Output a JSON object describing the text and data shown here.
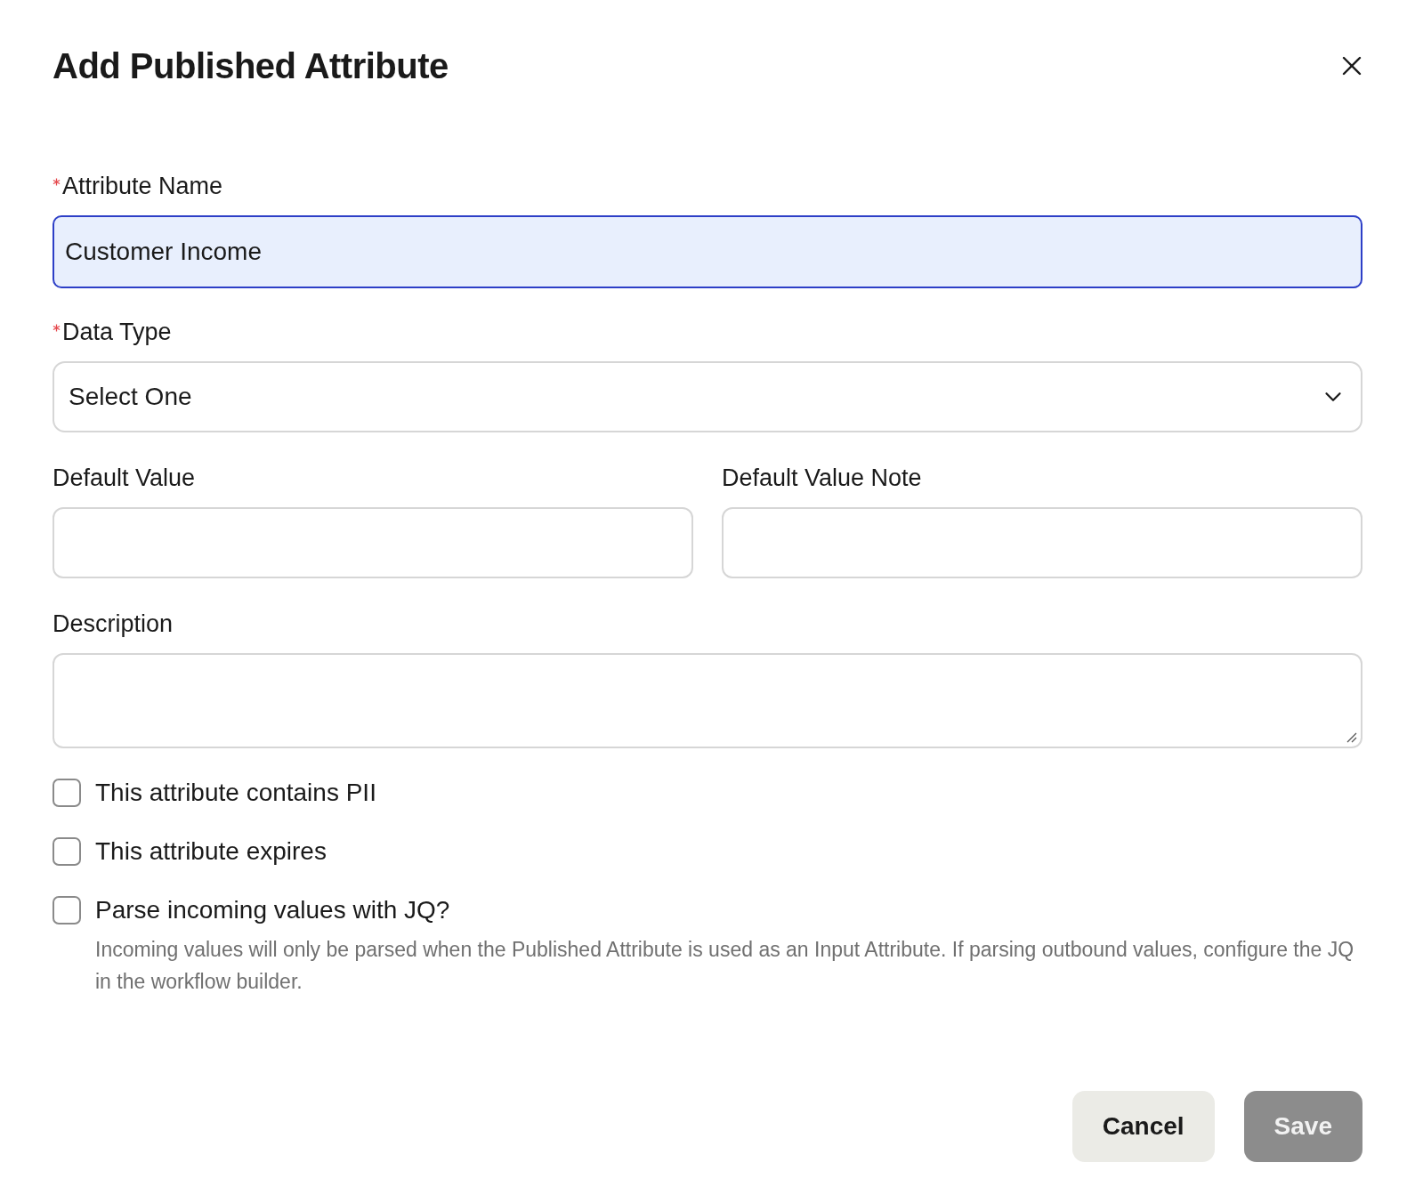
{
  "dialog": {
    "title": "Add Published Attribute"
  },
  "fields": [
    {
      "kind": "text",
      "label": "Attribute Name",
      "required": true,
      "value": "Customer Income",
      "focused": true
    },
    {
      "kind": "select",
      "label": "Data Type",
      "required": true,
      "value": "Select One",
      "focused": false
    }
  ],
  "row": [
    {
      "label": "Default Value"
    },
    {
      "label": "Default Value Note"
    }
  ],
  "description": {
    "label": "Description"
  },
  "checkboxes": [
    {
      "label": "This attribute contains PII",
      "checked": false
    },
    {
      "label": "This attribute expires",
      "checked": false
    },
    {
      "label": "Parse incoming values with JQ?",
      "checked": false,
      "help": "Incoming values will only be parsed when the Published Attribute is used as an Input Attribute. If parsing outbound values, configure the JQ in the workflow builder."
    }
  ],
  "buttons": [
    {
      "label": "Cancel",
      "kind": "secondary",
      "disabled": false
    },
    {
      "label": "Save",
      "kind": "primary",
      "disabled": true
    }
  ]
}
